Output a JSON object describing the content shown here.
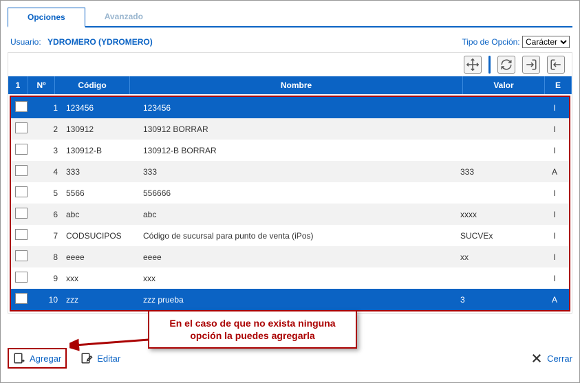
{
  "tabs": {
    "options": "Opciones",
    "advanced": "Avanzado"
  },
  "meta": {
    "user_label": "Usuario:",
    "user_value": "YDROMERO (YDROMERO)",
    "type_label": "Tipo de Opción:",
    "type_value": "Carácter"
  },
  "headers": {
    "sel": "1",
    "num": "Nº",
    "cod": "Código",
    "nom": "Nombre",
    "val": "Valor",
    "e": "E"
  },
  "rows": [
    {
      "n": "1",
      "cod": "123456",
      "nom": "123456",
      "val": "",
      "e": "I",
      "sel": true
    },
    {
      "n": "2",
      "cod": "130912",
      "nom": "130912 BORRAR",
      "val": "",
      "e": "I"
    },
    {
      "n": "3",
      "cod": "130912-B",
      "nom": "130912-B BORRAR",
      "val": "",
      "e": "I"
    },
    {
      "n": "4",
      "cod": "333",
      "nom": "333",
      "val": "333",
      "e": "A"
    },
    {
      "n": "5",
      "cod": "5566",
      "nom": "556666",
      "val": "",
      "e": "I"
    },
    {
      "n": "6",
      "cod": "abc",
      "nom": "abc",
      "val": "xxxx",
      "e": "I"
    },
    {
      "n": "7",
      "cod": "CODSUCIPOS",
      "nom": "Código de sucursal para punto de venta (iPos)",
      "val": "SUCVEx",
      "e": "I"
    },
    {
      "n": "8",
      "cod": "eeee",
      "nom": "eeee",
      "val": "xx",
      "e": "I"
    },
    {
      "n": "9",
      "cod": "xxx",
      "nom": "xxx",
      "val": "",
      "e": "I"
    },
    {
      "n": "10",
      "cod": "zzz",
      "nom": "zzz prueba",
      "val": "3",
      "e": "A",
      "sel": true
    }
  ],
  "footer": {
    "add": "Agregar",
    "edit": "Editar",
    "close": "Cerrar"
  },
  "callout": "En el caso de que no exista ninguna opción la puedes agregarla"
}
